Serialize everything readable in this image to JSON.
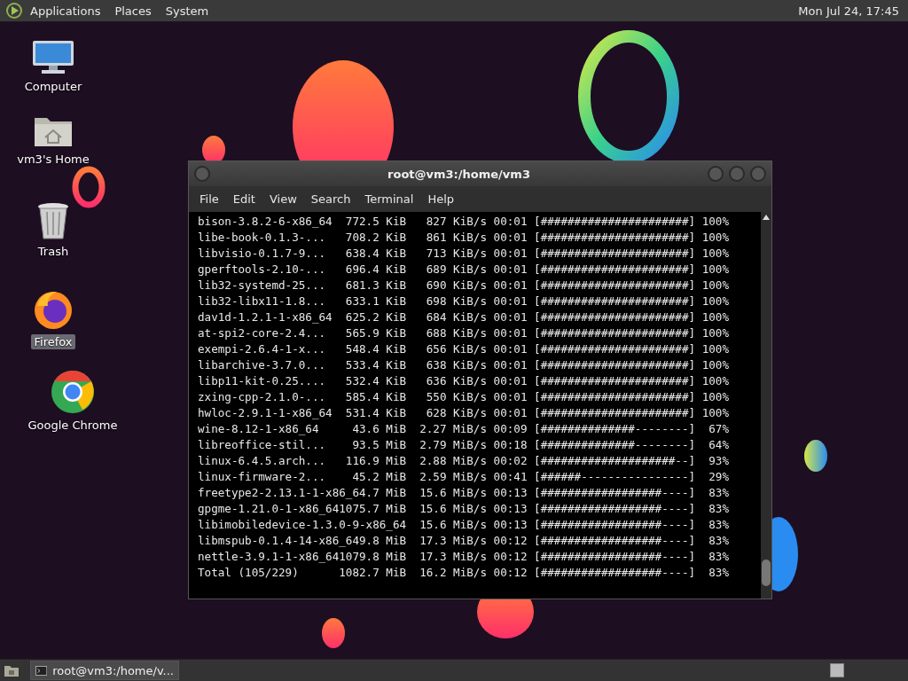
{
  "top_panel": {
    "menus": [
      "Applications",
      "Places",
      "System"
    ],
    "clock": "Mon Jul 24, 17:45"
  },
  "desktop_icons": [
    {
      "kind": "computer",
      "label": "Computer",
      "selected": false
    },
    {
      "kind": "home",
      "label": "vm3's Home",
      "selected": false
    },
    {
      "kind": "trash",
      "label": "Trash",
      "selected": false
    },
    {
      "kind": "firefox",
      "label": "Firefox",
      "selected": true
    },
    {
      "kind": "chrome",
      "label": "Google Chrome",
      "selected": false
    }
  ],
  "terminal": {
    "title": "root@vm3:/home/vm3",
    "menu": [
      "File",
      "Edit",
      "View",
      "Search",
      "Terminal",
      "Help"
    ],
    "lines": [
      "bison-3.8.2-6-x86_64  772.5 KiB   827 KiB/s 00:01 [######################] 100%",
      "libe-book-0.1.3-...   708.2 KiB   861 KiB/s 00:01 [######################] 100%",
      "libvisio-0.1.7-9...   638.4 KiB   713 KiB/s 00:01 [######################] 100%",
      "gperftools-2.10-...   696.4 KiB   689 KiB/s 00:01 [######################] 100%",
      "lib32-systemd-25...   681.3 KiB   690 KiB/s 00:01 [######################] 100%",
      "lib32-libx11-1.8...   633.1 KiB   698 KiB/s 00:01 [######################] 100%",
      "dav1d-1.2.1-1-x86_64  625.2 KiB   684 KiB/s 00:01 [######################] 100%",
      "at-spi2-core-2.4...   565.9 KiB   688 KiB/s 00:01 [######################] 100%",
      "exempi-2.6.4-1-x...   548.4 KiB   656 KiB/s 00:01 [######################] 100%",
      "libarchive-3.7.0...   533.4 KiB   638 KiB/s 00:01 [######################] 100%",
      "libp11-kit-0.25....   532.4 KiB   636 KiB/s 00:01 [######################] 100%",
      "zxing-cpp-2.1.0-...   585.4 KiB   550 KiB/s 00:01 [######################] 100%",
      "hwloc-2.9.1-1-x86_64  531.4 KiB   628 KiB/s 00:01 [######################] 100%",
      "wine-8.12-1-x86_64     43.6 MiB  2.27 MiB/s 00:09 [##############--------]  67%",
      "libreoffice-stil...    93.5 MiB  2.79 MiB/s 00:18 [##############--------]  64%",
      "linux-6.4.5.arch...   116.9 MiB  2.88 MiB/s 00:02 [####################--]  93%",
      "linux-firmware-2...    45.2 MiB  2.59 MiB/s 00:41 [######----------------]  29%",
      "freetype2-2.13.1-1-x86_64.7 MiB  15.6 MiB/s 00:13 [##################----]  83%",
      "gpgme-1.21.0-1-x86_641075.7 MiB  15.6 MiB/s 00:13 [##################----]  83%",
      "libimobiledevice-1.3.0-9-x86_64  15.6 MiB/s 00:13 [##################----]  83%",
      "libmspub-0.1.4-14-x86_649.8 MiB  17.3 MiB/s 00:12 [##################----]  83%",
      "nettle-3.9.1-1-x86_641079.8 MiB  17.3 MiB/s 00:12 [##################----]  83%",
      "Total (105/229)      1082.7 MiB  16.2 MiB/s 00:12 [##################----]  83%"
    ]
  },
  "taskbar": {
    "windows": [
      {
        "label": "root@vm3:/home/v...",
        "selected": false
      }
    ]
  }
}
